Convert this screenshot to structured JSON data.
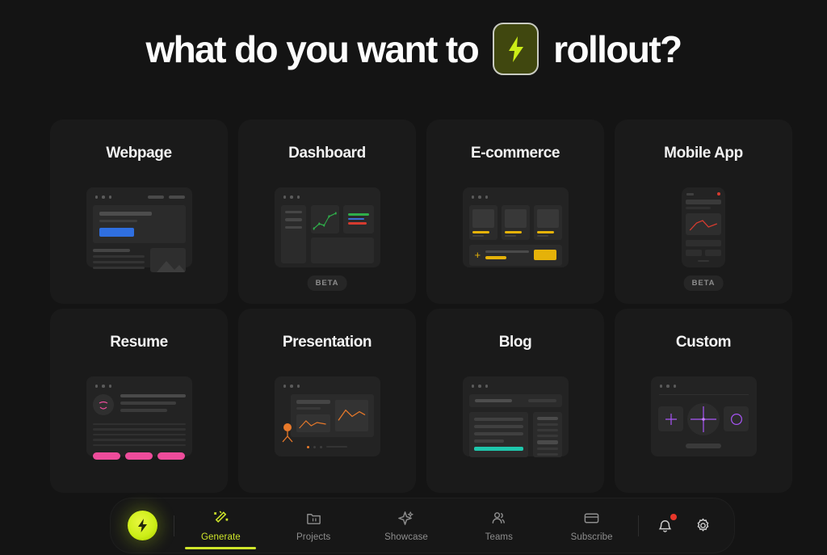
{
  "header": {
    "title_before": "what do you want to",
    "title_after": "rollout?",
    "badge_icon": "lightning-bolt-icon",
    "badge_bg": "#40470f",
    "badge_bolt_color": "#ccee17"
  },
  "cards": [
    {
      "title": "Webpage",
      "mockup": "browser-webpage",
      "accent": "#2f6fe0",
      "badge": null
    },
    {
      "title": "Dashboard",
      "mockup": "browser-dashboard",
      "accent": "#2fae4a",
      "badge": "BETA"
    },
    {
      "title": "E-commerce",
      "mockup": "browser-ecommerce",
      "accent": "#e5b209",
      "badge": null
    },
    {
      "title": "Mobile App",
      "mockup": "phone-mobile-app",
      "accent": "#d63b2f",
      "badge": "BETA"
    },
    {
      "title": "Resume",
      "mockup": "browser-resume",
      "accent": "#ee4c9b",
      "badge": null
    },
    {
      "title": "Presentation",
      "mockup": "browser-presentation",
      "accent": "#e8792a",
      "badge": null
    },
    {
      "title": "Blog",
      "mockup": "browser-blog",
      "accent": "#1fc7ad",
      "badge": null
    },
    {
      "title": "Custom",
      "mockup": "browser-custom",
      "accent": "#a855f7",
      "badge": null
    }
  ],
  "navbar": {
    "logo_icon": "lightning-bolt-logo-icon",
    "items": [
      {
        "label": "Generate",
        "icon": "magic-wand-icon",
        "active": true
      },
      {
        "label": "Projects",
        "icon": "folder-icon",
        "active": false
      },
      {
        "label": "Showcase",
        "icon": "sparkle-icon",
        "active": false
      },
      {
        "label": "Teams",
        "icon": "users-icon",
        "active": false
      },
      {
        "label": "Subscribe",
        "icon": "card-icon",
        "active": false
      }
    ],
    "actions": [
      {
        "icon": "bell-icon",
        "badge": true
      },
      {
        "icon": "gear-icon",
        "badge": false
      }
    ],
    "active_color": "#cfe62a",
    "badge_color": "#e8372a"
  }
}
